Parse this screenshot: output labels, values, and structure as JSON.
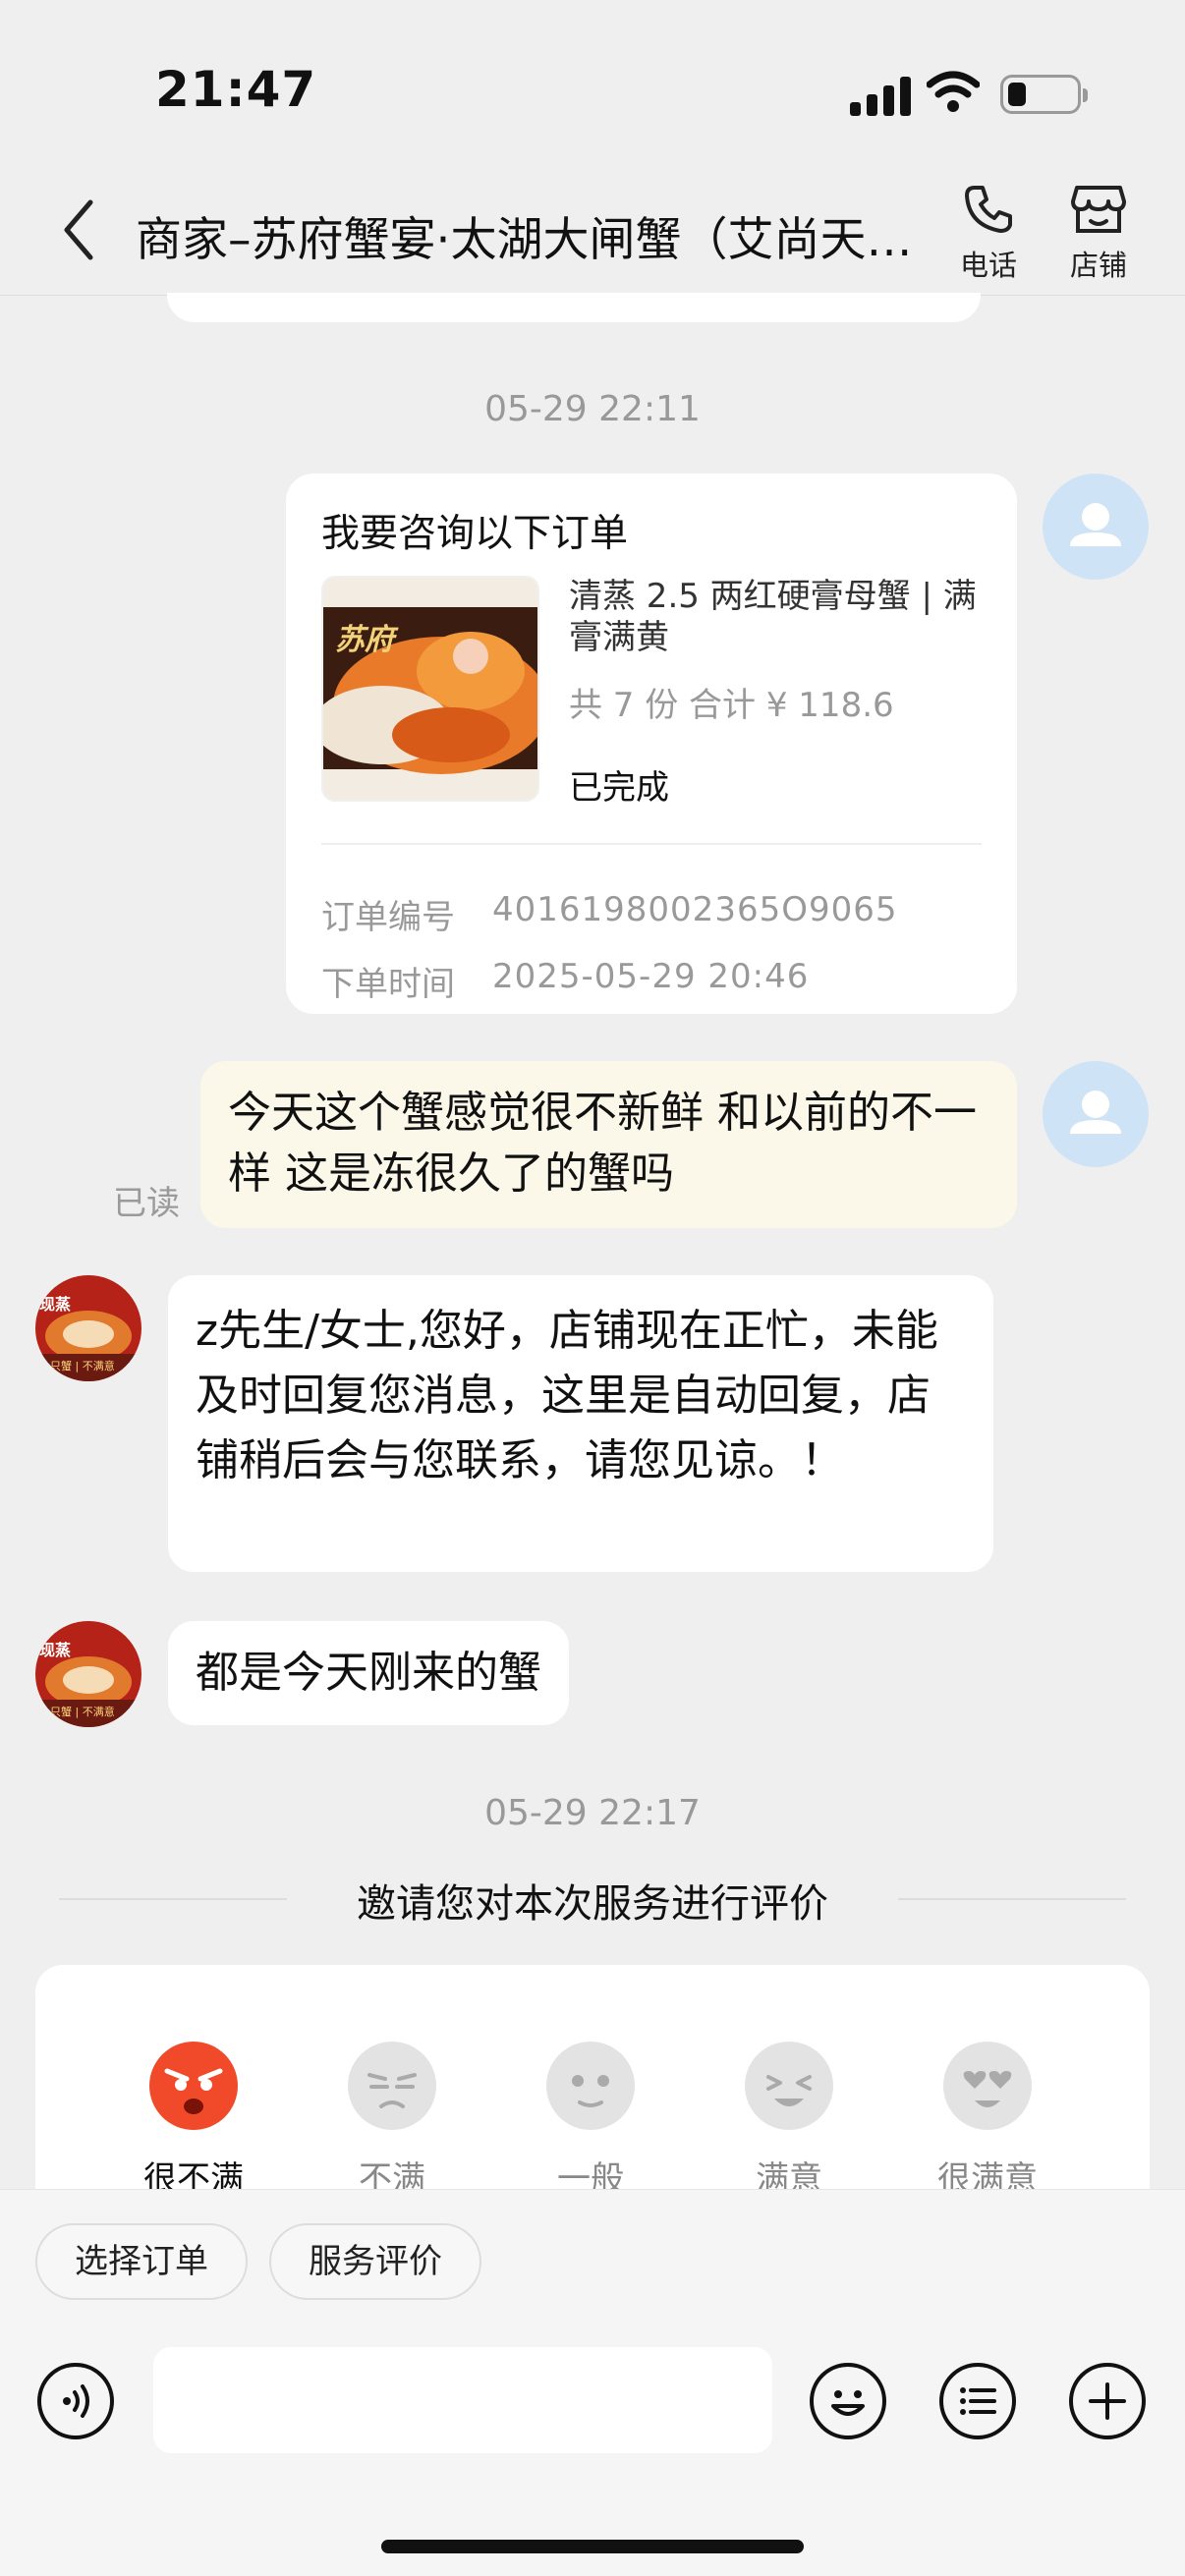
{
  "status": {
    "time": "21:47"
  },
  "header": {
    "title": "商家–苏府蟹宴·太湖大闸蟹（艾尚天地店）",
    "phone_label": "电话",
    "shop_label": "店铺"
  },
  "chat": {
    "timestamp_1": "05-29 22:11",
    "order_card": {
      "title": "我要咨询以下订单",
      "thumb_text": "苏府",
      "product_name": "清蒸 2.5 两红硬膏母蟹 | 满膏满黄",
      "summary": "共 7 份  合计 ¥ 118.6",
      "status": "已完成",
      "order_no_label": "订单编号",
      "order_no": "4016198002365O9065",
      "order_time_label": "下单时间",
      "order_time": "2025-05-29 20:46"
    },
    "user_message": "今天这个蟹感觉很不新鲜 和以前的不一样 这是冻很久了的蟹吗",
    "read_label": "已读",
    "auto_reply": "z先生/女士,您好，店铺现在正忙，未能及时回复您消息，这里是自动回复，店铺稍后会与您联系，请您见谅。！",
    "shop_reply": "都是今天刚来的蟹",
    "timestamp_2": "05-29 22:17",
    "shop_avatar_text_top": "现蒸",
    "shop_avatar_text_bottom": "一只蟹 | 不满意"
  },
  "evaluation": {
    "title": "邀请您对本次服务进行评价",
    "options": [
      "很不满",
      "不满",
      "一般",
      "满意",
      "很满意"
    ]
  },
  "bottom": {
    "chip_1": "选择订单",
    "chip_2": "服务评价"
  },
  "colors": {
    "angry_face": "#f04a2a",
    "accent_avatar": "#cfe3f6",
    "user_bubble": "#fbf8ea"
  }
}
